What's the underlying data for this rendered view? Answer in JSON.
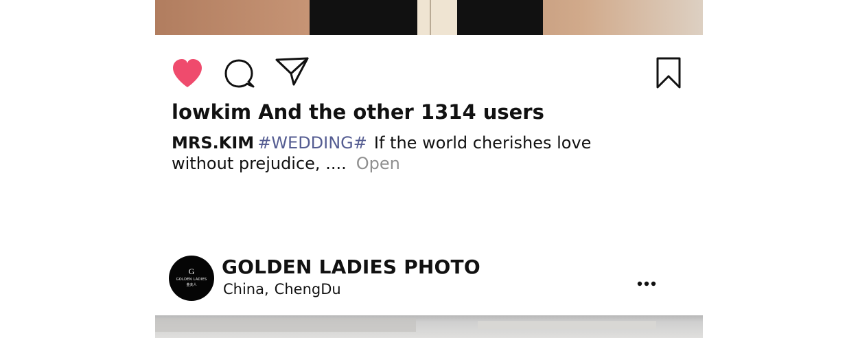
{
  "post": {
    "likes_text": "lowkim And the other 1314 users",
    "caption": {
      "username": "MRS.KIM",
      "hashtag": "#WEDDING#",
      "text": "If the world cherishes love without prejudice, ....",
      "open_label": "Open"
    },
    "action_icons": {
      "like": "heart-icon",
      "comment": "comment-icon",
      "share": "send-icon",
      "save": "bookmark-icon"
    },
    "like_color": "#ef4b6d"
  },
  "next_post": {
    "account_name": "GOLDEN LADIES PHOTO",
    "location": {
      "country": "China,",
      "city": "ChengDu"
    },
    "avatar_text": {
      "mark": "G",
      "name": "GOLDEN LADIES",
      "sub": "金夫人"
    },
    "menu_icon": "more-icon"
  },
  "colors": {
    "hashtag": "#555d92",
    "secondary_text": "#8f8f8f",
    "text": "#111111"
  }
}
